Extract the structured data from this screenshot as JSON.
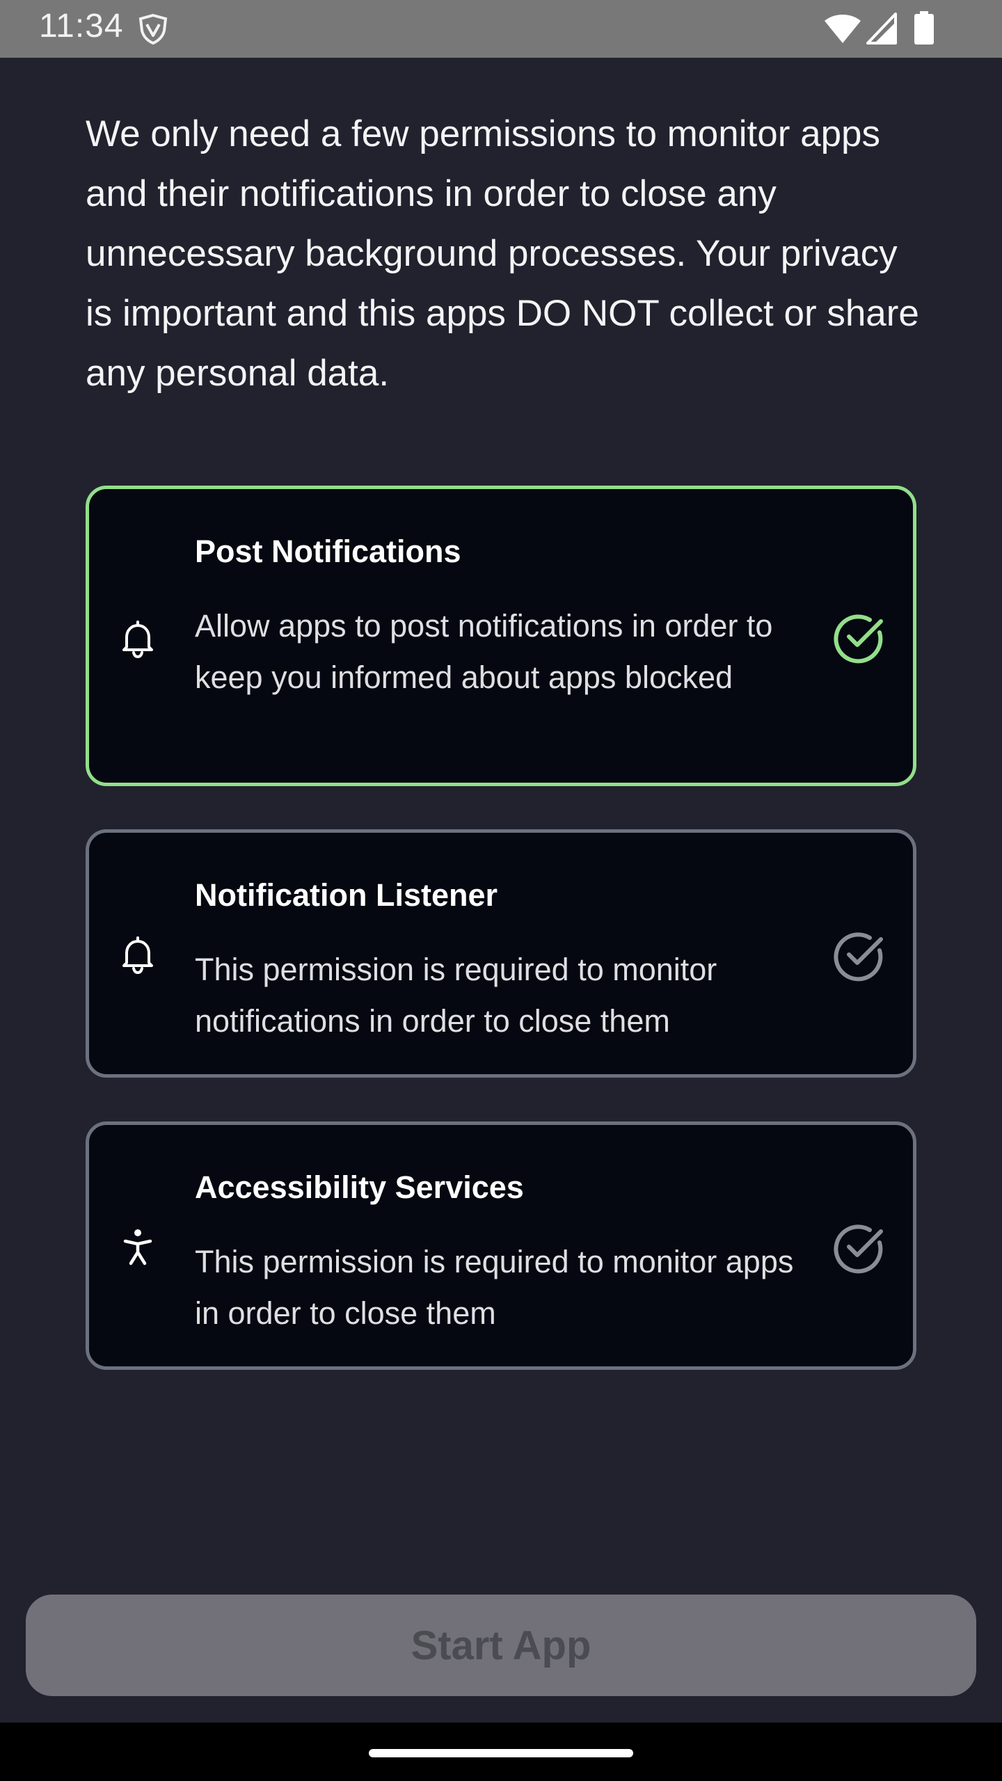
{
  "status_bar": {
    "time": "11:34",
    "icons": [
      "shield-vpn-icon",
      "wifi-icon",
      "signal-icon",
      "battery-icon"
    ]
  },
  "intro_text": "We only need a few permissions to monitor apps and their notifications in order to close any unnecessary background processes. Your privacy is important and this apps DO NOT collect or share any personal data.",
  "permissions": [
    {
      "title": "Post Notifications",
      "description": "Allow apps to post notifications in order to keep you informed about apps blocked",
      "icon": "bell-icon",
      "granted": true
    },
    {
      "title": "Notification Listener",
      "description": "This permission is required to monitor notifications in order to close them",
      "icon": "bell-icon",
      "granted": false
    },
    {
      "title": "Accessibility Services",
      "description": "This permission is required to monitor apps in order to close them",
      "icon": "accessibility-icon",
      "granted": false
    }
  ],
  "start_button": {
    "label": "Start App",
    "enabled": false
  },
  "colors": {
    "background": "#22222e",
    "card_background": "#050810",
    "granted_accent": "#92df8a",
    "inactive_border": "#6c7180",
    "button_disabled": "#727179"
  }
}
